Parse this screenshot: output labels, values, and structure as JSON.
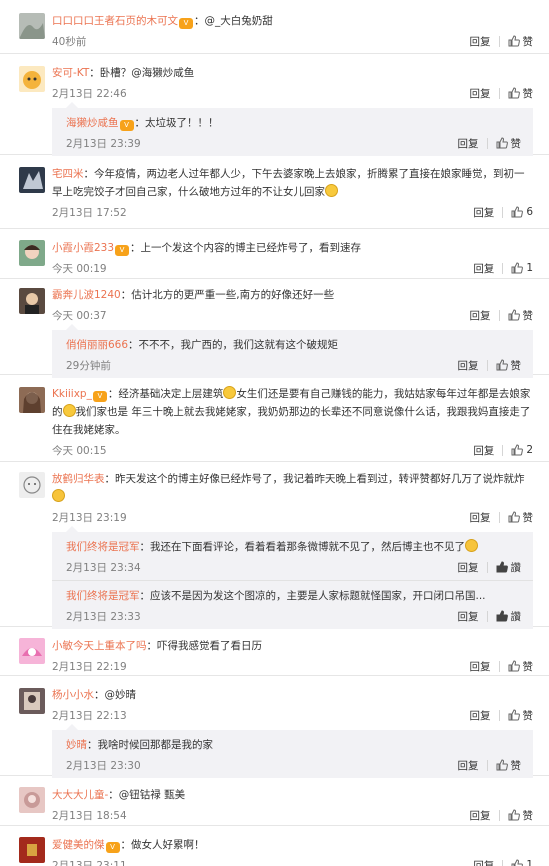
{
  "actions": {
    "reply": "回复",
    "like": "赞",
    "reply_alt": "回复",
    "like_alt": "讚"
  },
  "colors": {
    "username": "#eb7350",
    "text": "#333333",
    "meta": "#808080",
    "subBackground": "#f2f2f5"
  },
  "comments": [
    {
      "user": "口口口口王者石页的木可文",
      "vip": true,
      "body": "：@_大白兔奶甜",
      "time": "40秒前",
      "likes": "",
      "avatar_color": "#9aa49a"
    },
    {
      "user": "安可-KT",
      "vip": false,
      "body": "：卧槽？@海獭炒咸鱼",
      "time": "2月13日 22:46",
      "likes": "",
      "avatar_color": "#f4b33c",
      "replies": [
        {
          "user": "海獭炒咸鱼",
          "vip": true,
          "body": "：太垃圾了！！！",
          "time": "2月13日 23:39",
          "likes": ""
        }
      ]
    },
    {
      "user": "宅四米",
      "vip": false,
      "body": "：今年疫情，两边老人过年都人少，下午去婆家晚上去娘家，折腾累了直接在娘家睡觉，到初一早上吃完饺子才回自己家，什么破地方过年的不让女儿回家",
      "emoji": true,
      "time": "2月13日 17:52",
      "likes": "6",
      "avatar_color": "#2f3a4a"
    },
    {
      "user": "小霞小霞233",
      "vip": true,
      "body": "：上一个发这个内容的博主已经炸号了，看到速存",
      "time": "今天 00:19",
      "likes": "1",
      "avatar_color": "#5a8f6a"
    },
    {
      "user": "霸奔儿波1240",
      "vip": false,
      "body": "：估计北方的更严重一些,南方的好像还好一些",
      "time": "今天 00:37",
      "likes": "",
      "avatar_color": "#4b3b33",
      "replies": [
        {
          "user": "俏俏丽丽666",
          "vip": false,
          "body": "：不不不，我广西的，我们这就有这个破规矩",
          "time": "29分钟前",
          "likes": ""
        }
      ]
    },
    {
      "user": "Kkiiixp_",
      "vip": true,
      "body": "：经济基础决定上层建筑",
      "body2": "女生们还是要有自己赚钱的能力，我姑姑家每年过年都是去娘家的",
      "body3": "我们家也是 年三十晚上就去我姥姥家，我奶奶那边的长辈还不同意说像什么话，我跟我妈直接走了住在我姥姥家。",
      "time": "今天 00:15",
      "likes": "2",
      "avatar_color": "#6d4a3a"
    },
    {
      "user": "放鹤归华表",
      "vip": false,
      "body": "：昨天发这个的博主好像已经炸号了，我记着昨天晚上看到过，转评赞都好几万了说炸就炸",
      "emoji": true,
      "time": "2月13日 23:19",
      "likes": "",
      "avatar_color": "#d9d9d9",
      "replies": [
        {
          "user": "我们终将是冠军",
          "vip": false,
          "body": "：我还在下面看评论，看着看着那条微博就不见了，然后博主也不见了",
          "emoji": true,
          "time": "2月13日 23:34",
          "likes": "",
          "alt": true
        },
        {
          "user": "我们终将是冠军",
          "vip": false,
          "body": "：应该不是因为发这个图凉的，主要是人家标题就怪国家，开口闭口吊国...",
          "time": "2月13日 23:33",
          "likes": "",
          "alt": true
        }
      ]
    },
    {
      "user": "小敏今天上重本了吗",
      "vip": false,
      "body": "：吓得我感觉看了看日历",
      "time": "2月13日 22:19",
      "likes": "",
      "avatar_color": "#e86fb0"
    },
    {
      "user": "杨小小水",
      "vip": false,
      "body": "：@妙晴",
      "time": "2月13日 22:13",
      "likes": "",
      "avatar_color": "#4a3c3c",
      "replies": [
        {
          "user": "妙晴",
          "vip": false,
          "body": "：我啥时候回那都是我的家",
          "time": "2月13日 23:30",
          "likes": ""
        }
      ]
    },
    {
      "user": "大大大儿童-",
      "vip": false,
      "body": "：@钮钴禄 甄美",
      "time": "2月13日 18:54",
      "likes": "",
      "avatar_color": "#c89a98"
    },
    {
      "user": "爱健美的傑",
      "vip": true,
      "body": "：做女人好累啊！",
      "time": "2月13日 23:11",
      "likes": "1",
      "avatar_color": "#a32a1c"
    }
  ]
}
